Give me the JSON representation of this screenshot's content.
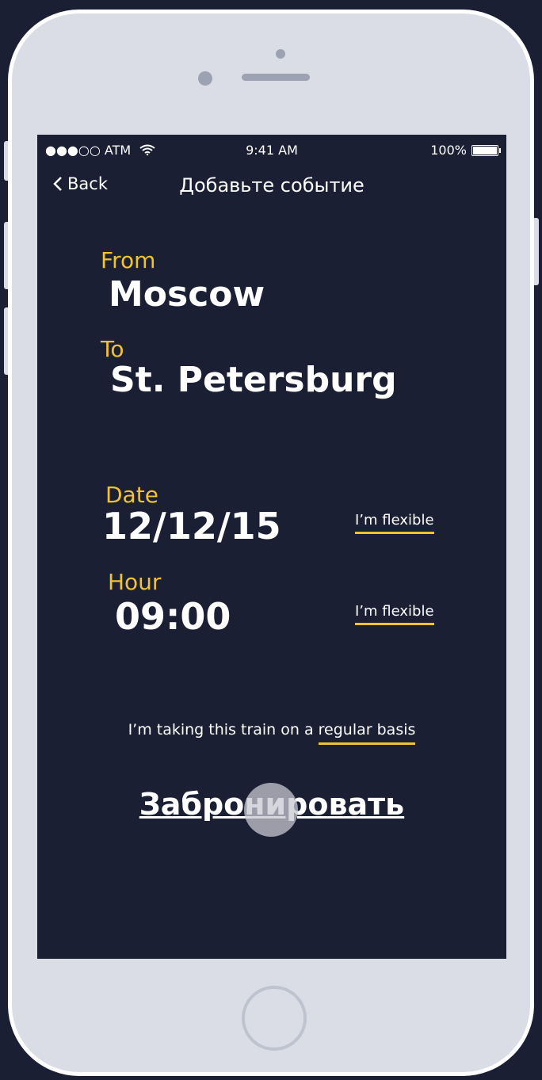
{
  "status_bar": {
    "carrier": "●●●○○ ATM",
    "time": "9:41 AM",
    "battery": "100%"
  },
  "nav": {
    "back_label": "Back",
    "title": "Добавьте событие"
  },
  "route": {
    "from_label": "From",
    "from_value": "Moscow",
    "to_label": "To",
    "to_value": "St. Petersburg"
  },
  "date": {
    "label": "Date",
    "value": "12/12/15",
    "flexible": "I’m flexible"
  },
  "hour": {
    "label": "Hour",
    "value": "09:00",
    "flexible": "I’m flexible"
  },
  "regular": {
    "prefix": "I’m taking this train on a ",
    "link": "regular basis"
  },
  "book_button": "Забронировать",
  "colors": {
    "background": "#1a1f33",
    "accent": "#f2c230",
    "device": "#dadde6"
  }
}
